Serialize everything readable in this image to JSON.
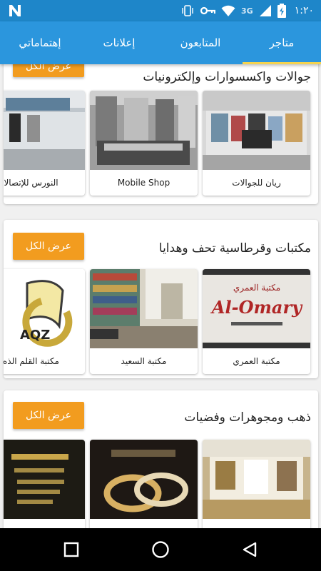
{
  "status_bar": {
    "network": "3G",
    "time": "١:٢٠",
    "icons": [
      "n-app-icon",
      "vibrate-icon",
      "key-icon",
      "wifi-icon",
      "signal-icon",
      "battery-charging-icon"
    ]
  },
  "tabs": [
    {
      "label": "متاجر",
      "active": true
    },
    {
      "label": "المتابعون",
      "active": false
    },
    {
      "label": "إعلانات",
      "active": false
    },
    {
      "label": "إهتماماتي",
      "active": false
    }
  ],
  "sections": [
    {
      "title": "جوالات واكسسوارات وإلكترونيات",
      "view_all": "عرض الكل",
      "stores": [
        {
          "name": "ريان للجوالات"
        },
        {
          "name": "Mobile Shop"
        },
        {
          "name": "النورس للإتصالا"
        }
      ]
    },
    {
      "title": "مكتبات وقرطاسية تحف وهدايا",
      "view_all": "عرض الكل",
      "stores": [
        {
          "name": "مكتبة العمري",
          "logo_text": "Al-Omary",
          "logo_sub": "مكتبة العمري"
        },
        {
          "name": "مكتبة السعيد"
        },
        {
          "name": "مكتبة القلم الذه",
          "logo_text": "AQZ"
        }
      ]
    },
    {
      "title": "ذهب ومجوهرات وفضيات",
      "view_all": "عرض الكل",
      "stores": [
        {
          "name": ""
        },
        {
          "name": ""
        },
        {
          "name": ""
        }
      ]
    }
  ],
  "nav": [
    "recents-square-icon",
    "home-circle-icon",
    "back-triangle-icon"
  ],
  "colors": {
    "status_bar": "#1e86c9",
    "tab_bar": "#2b96dd",
    "tab_indicator": "#f5d34f",
    "button": "#f29c1f"
  }
}
